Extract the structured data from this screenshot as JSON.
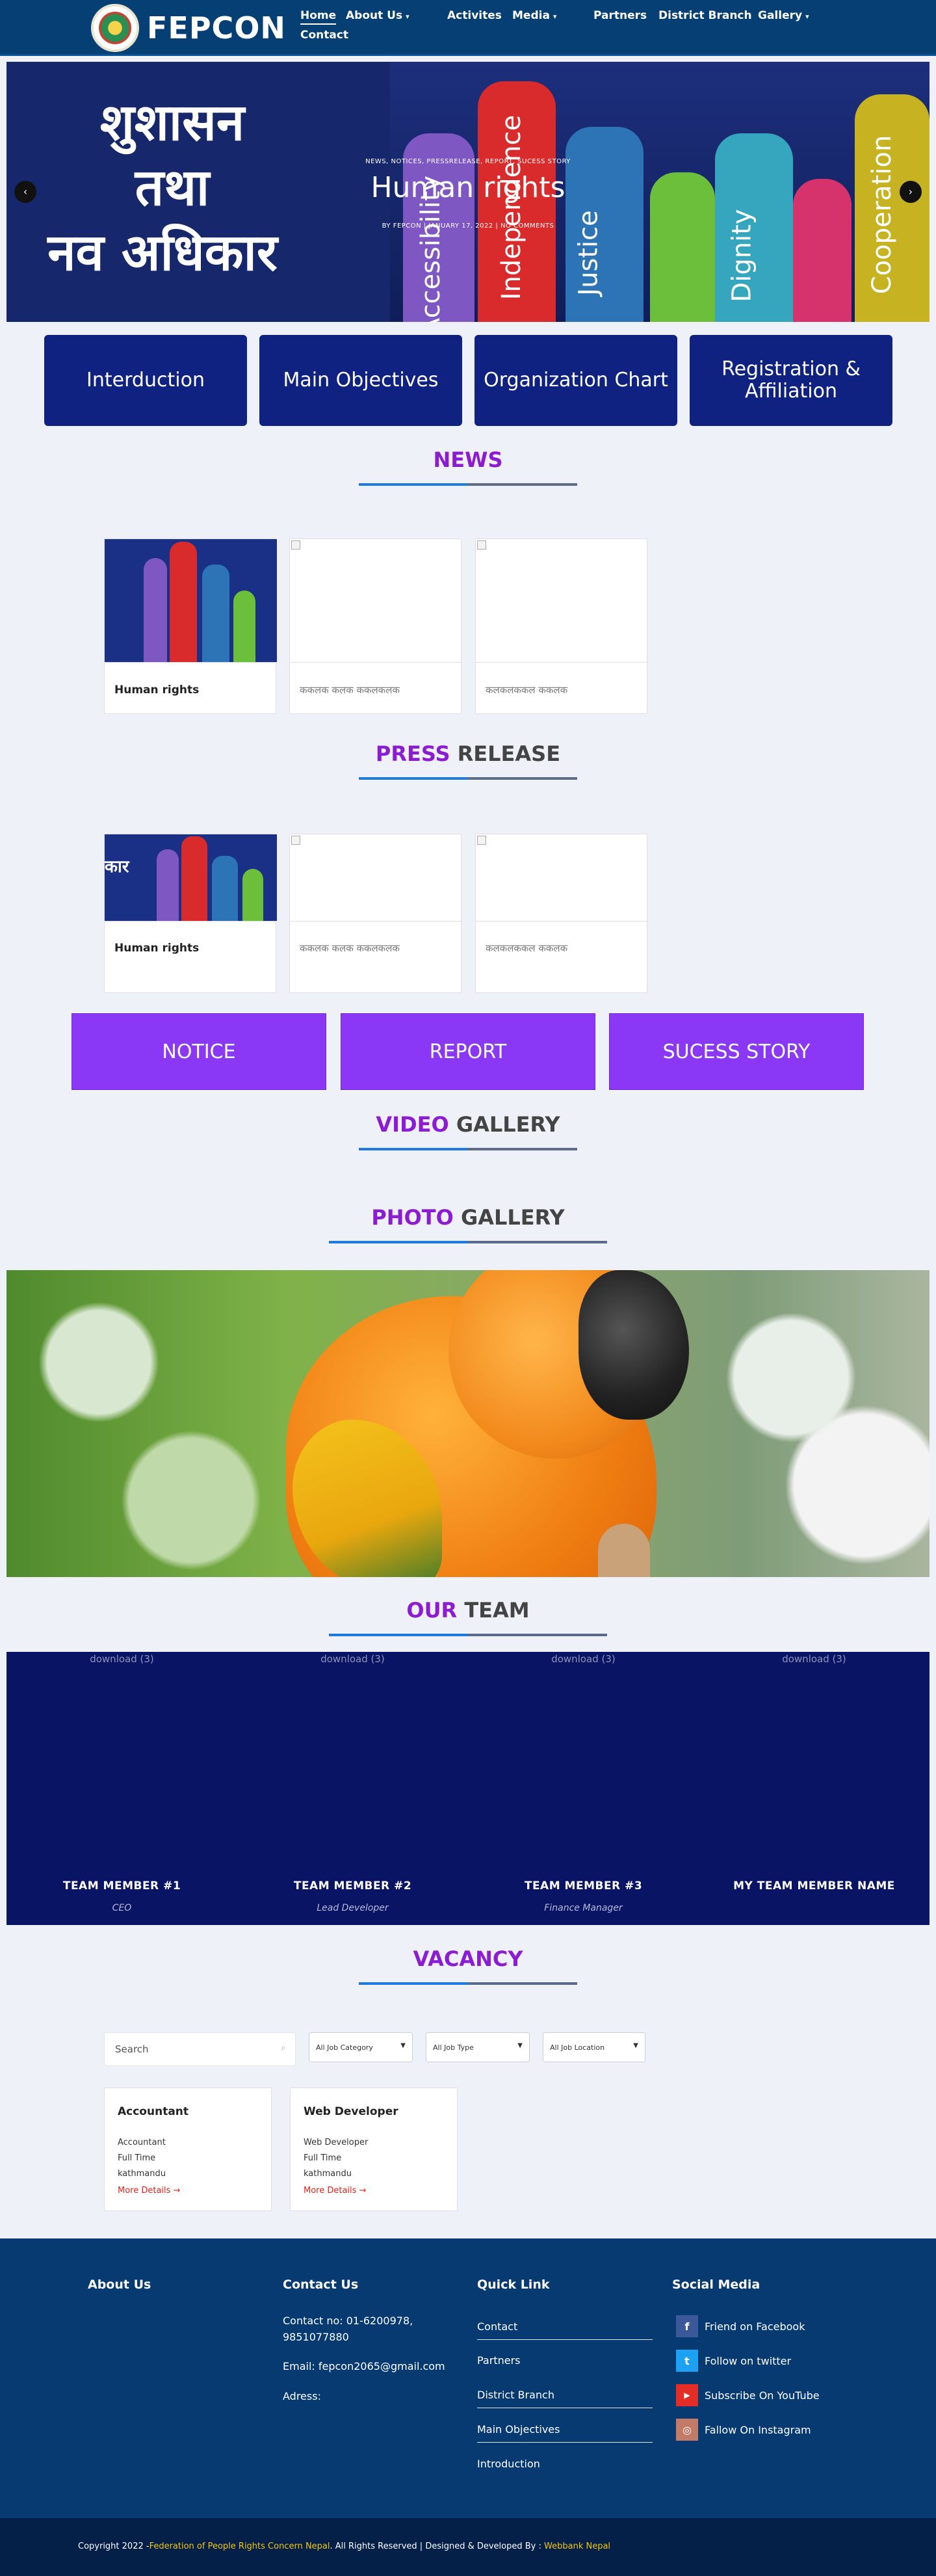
{
  "header": {
    "brand": "FEPCON",
    "nav": [
      {
        "label": "Home",
        "caret": false
      },
      {
        "label": "About Us",
        "caret": true
      },
      {
        "label": "Activites",
        "caret": false
      },
      {
        "label": "Media",
        "caret": true
      },
      {
        "label": "Partners",
        "caret": false
      },
      {
        "label": "District Branch",
        "caret": false
      },
      {
        "label": "Gallery",
        "caret": true
      },
      {
        "label": "Contact",
        "caret": false
      }
    ]
  },
  "hero": {
    "nepali_lines": [
      "शुशासन",
      "तथा",
      "नव अधिकार"
    ],
    "hand_words": [
      "Accessibility",
      "Independence",
      "Justice",
      "Dignity",
      "Cooperation"
    ],
    "meta_top": "NEWS, NOTICES, PRESSRELEASE, REPORT, SUCESS STORY",
    "title": "Human rights",
    "meta_bottom": "BY FEPCON | JANUARY 17, 2022 | NO COMMENTS",
    "prev_label": "‹",
    "next_label": "›"
  },
  "tiles": [
    "Interduction",
    "Main Objectives",
    "Organization Chart",
    "Registration & Affiliation"
  ],
  "news": {
    "heading_a": "NEWS",
    "cards": [
      {
        "title": "Human rights"
      },
      {
        "title": "ककलक कलक ककलकलक"
      },
      {
        "title": "कलकलककल ककलक"
      }
    ]
  },
  "press": {
    "heading_a": "PRESS",
    "heading_b": "RELEASE",
    "cards": [
      {
        "title": "Human rights"
      },
      {
        "title": "ककलक कलक ककलकलक"
      },
      {
        "title": "कलकलककल ककलक"
      }
    ]
  },
  "buttons": [
    "NOTICE",
    "REPORT",
    "SUCESS STORY"
  ],
  "video": {
    "heading_a": "VIDEO",
    "heading_b": "GALLERY"
  },
  "photo": {
    "heading_a": "PHOTO",
    "heading_b": "GALLERY"
  },
  "team": {
    "heading_a": "OUR",
    "heading_b": "TEAM",
    "members": [
      {
        "alt": "download (3)",
        "name": "TEAM MEMBER #1",
        "role": "CEO"
      },
      {
        "alt": "download (3)",
        "name": "TEAM MEMBER #2",
        "role": "Lead Developer"
      },
      {
        "alt": "download (3)",
        "name": "TEAM MEMBER #3",
        "role": "Finance Manager"
      },
      {
        "alt": "download (3)",
        "name": "MY TEAM MEMBER NAME",
        "role": ""
      }
    ]
  },
  "vacancy": {
    "heading": "VACANCY",
    "search_placeholder": "Search",
    "filters": [
      "All Job Category",
      "All Job Type",
      "All Job Location"
    ],
    "jobs": [
      {
        "title": "Accountant",
        "lines": [
          "Accountant",
          "Full Time",
          "kathmandu"
        ],
        "more": "More Details →"
      },
      {
        "title": "Web Developer",
        "lines": [
          "Web Developer",
          "Full Time",
          "kathmandu"
        ],
        "more": "More Details →"
      }
    ]
  },
  "footer": {
    "about_heading": "About Us",
    "contact_heading": "Contact Us",
    "contact_no": "Contact no: 01-6200978,",
    "contact_no2": "9851077880",
    "email": "Email: fepcon2065@gmail.com",
    "address": "Adress:",
    "quick_heading": "Quick Link",
    "quick_links": [
      "Contact",
      "Partners",
      "District Branch",
      "Main Objectives",
      "Introduction"
    ],
    "social_heading": "Social Media",
    "social": [
      {
        "label": "Friend on Facebook",
        "icon": "f",
        "color": "#3b5998"
      },
      {
        "label": "Follow on twitter",
        "icon": "t",
        "color": "#1da1f2"
      },
      {
        "label": "Subscribe On YouTube",
        "icon": "▶",
        "color": "#e52d27"
      },
      {
        "label": "Fallow On Instagram",
        "icon": "◎",
        "color": "#c27b66"
      }
    ]
  },
  "copyright": {
    "prefix": "Copyright 2022 -",
    "org": "Federation of People Rights Concern Nepal",
    "middle": ". All Rights Reserved | Designed & Developed By : ",
    "dev": "Webbank Nepal"
  }
}
